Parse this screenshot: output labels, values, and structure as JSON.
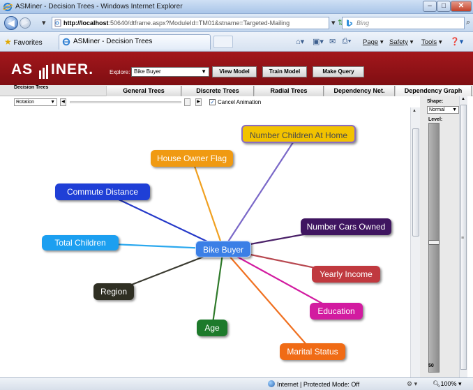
{
  "browser": {
    "window_title": "ASMiner - Decision Trees - Windows Internet Explorer",
    "url_host": "http://localhost",
    "url_rest": ":50640/dtframe.aspx?ModuleId=TM01&stname=Targeted-Mailing",
    "search_placeholder": "Bing",
    "favorites_label": "Favorites",
    "tab_title": "ASMiner - Decision Trees",
    "commands": {
      "page": "Page",
      "safety": "Safety",
      "tools": "Tools"
    },
    "status_zone": "Internet | Protected Mode: Off",
    "zoom": "100%"
  },
  "app": {
    "logo_left": "AS",
    "logo_right": "INER.",
    "section_label": "Decision Trees",
    "explore_label": "Explore:",
    "explore_value": "Bike Buyer",
    "buttons": {
      "view_model": "View Model",
      "train_model": "Train Model",
      "make_query": "Make Query"
    },
    "tabs": [
      "General Trees",
      "Discrete Trees",
      "Radial Trees",
      "Dependency Net.",
      "Dependency Graph"
    ],
    "toolbar": {
      "rotation_value": "Rotation",
      "cancel_animation_label": "Cancel Animation"
    },
    "side": {
      "shape_label": "Shape:",
      "shape_value": "Normal",
      "level_label": "Level:",
      "level_value": "50"
    }
  },
  "graph": {
    "center": {
      "label": "Bike Buyer",
      "color": "#3b7fe6"
    },
    "nodes": [
      {
        "label": "Number Children At Home",
        "color": "#f2c200",
        "edge_color": "#7a68c8"
      },
      {
        "label": "House Owner Flag",
        "color": "#f09a12",
        "edge_color": "#f0a020"
      },
      {
        "label": "Commute Distance",
        "color": "#1f3fd6",
        "edge_color": "#2438c8"
      },
      {
        "label": "Number Cars Owned",
        "color": "#3f1560",
        "edge_color": "#4a2068"
      },
      {
        "label": "Total Children",
        "color": "#1c9ff0",
        "edge_color": "#2ba8ee"
      },
      {
        "label": "Yearly Income",
        "color": "#c0393f",
        "edge_color": "#b84850"
      },
      {
        "label": "Region",
        "color": "#2f2f23",
        "edge_color": "#3a3a30"
      },
      {
        "label": "Education",
        "color": "#d21ba0",
        "edge_color": "#d21ba0"
      },
      {
        "label": "Age",
        "color": "#1d7a2b",
        "edge_color": "#2f7a2a"
      },
      {
        "label": "Marital Status",
        "color": "#f06b15",
        "edge_color": "#f07020"
      }
    ]
  }
}
